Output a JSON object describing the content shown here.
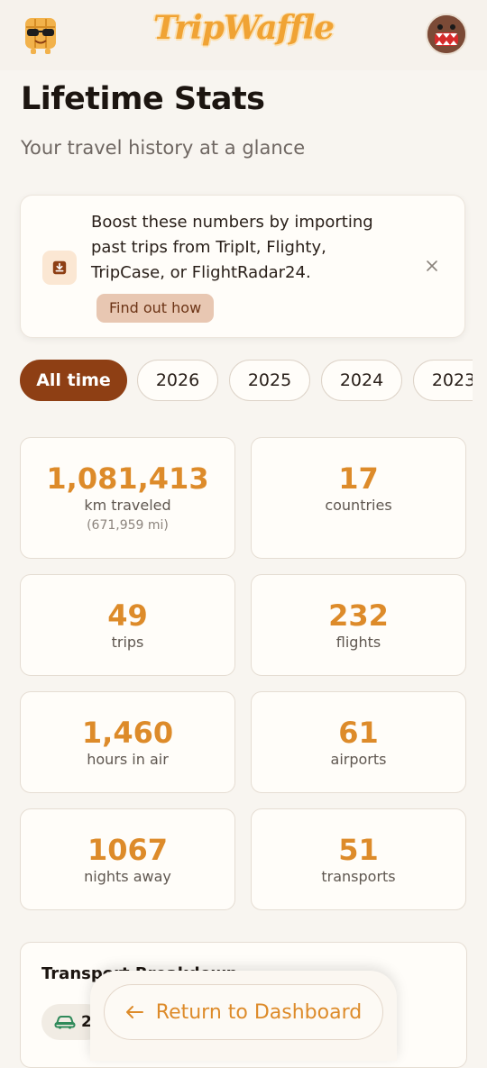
{
  "header": {
    "logo_text": "TripWaffle",
    "mascot_icon": "waffle-mascot-icon",
    "avatar_icon": "domo-avatar-icon"
  },
  "page": {
    "title": "Lifetime Stats",
    "subtitle": "Your travel history at a glance"
  },
  "banner": {
    "text": "Boost these numbers by importing past trips from TripIt, Flighty, TripCase, or FlightRadar24.",
    "link_label": "Find out how",
    "icon": "import-download-icon",
    "close_icon": "close-icon"
  },
  "filters": {
    "chips": [
      "All time",
      "2026",
      "2025",
      "2024",
      "2023"
    ],
    "selected": "All time"
  },
  "stats": [
    {
      "value": "1,081,413",
      "label": "km traveled",
      "sub": "(671,959 mi)"
    },
    {
      "value": "17",
      "label": "countries"
    },
    {
      "value": "49",
      "label": "trips"
    },
    {
      "value": "232",
      "label": "flights"
    },
    {
      "value": "1,460",
      "label": "hours in air"
    },
    {
      "value": "61",
      "label": "airports"
    },
    {
      "value": "1067",
      "label": "nights away"
    },
    {
      "value": "51",
      "label": "transports"
    }
  ],
  "breakdown": {
    "title": "Transport Breakdown",
    "items": [
      {
        "icon": "car-icon",
        "count": "2"
      }
    ]
  },
  "footer": {
    "return_label": "Return to Dashboard",
    "return_icon": "arrow-left-icon"
  },
  "colors": {
    "accent_orange": "#dd8b2a",
    "active_chip": "#8e3f14",
    "background": "#f8f5f0"
  }
}
